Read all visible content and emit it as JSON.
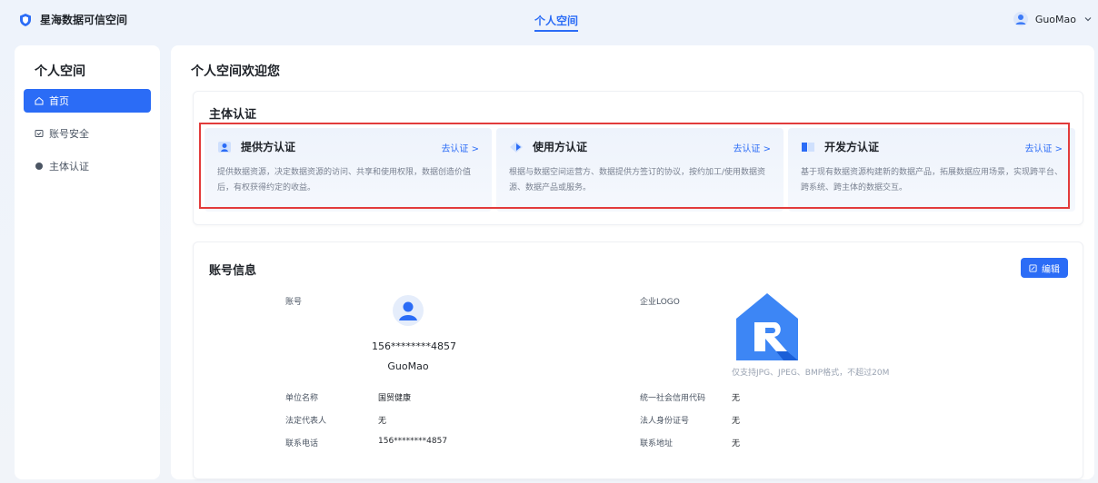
{
  "header": {
    "app_name": "星海数据可信空间",
    "nav_active": "个人空间",
    "user_name": "GuoMao"
  },
  "sidebar": {
    "title": "个人空间",
    "items": [
      {
        "label": "首页",
        "icon": "home-icon",
        "active": true
      },
      {
        "label": "账号安全",
        "icon": "shield-icon",
        "active": false
      },
      {
        "label": "主体认证",
        "icon": "dot-icon",
        "active": false
      }
    ]
  },
  "main": {
    "welcome": "个人空间欢迎您",
    "auth": {
      "title": "主体认证",
      "tiles": [
        {
          "name": "提供方认证",
          "link": "去认证 >",
          "desc": "提供数据资源，决定数据资源的访问、共享和使用权限，数据创造价值后，有权获得约定的收益。",
          "icon": "provider-icon"
        },
        {
          "name": "使用方认证",
          "link": "去认证 >",
          "desc": "根据与数据空间运营方、数据提供方签订的协议，按约加工/使用数据资源、数据产品或服务。",
          "icon": "user-icon"
        },
        {
          "name": "开发方认证",
          "link": "去认证 >",
          "desc": "基于现有数据资源构建新的数据产品，拓展数据应用场景，实现跨平台、跨系统、跨主体的数据交互。",
          "icon": "developer-icon"
        }
      ]
    },
    "account": {
      "title": "账号信息",
      "edit_label": "编辑",
      "account_label": "账号",
      "phone_masked": "156********4857",
      "username": "GuoMao",
      "logo_label": "企业LOGO",
      "logo_hint": "仅支持JPG、JPEG、BMP格式，不超过20M",
      "fields_left": [
        {
          "label": "单位名称",
          "value": "国贸健康"
        },
        {
          "label": "法定代表人",
          "value": "无"
        },
        {
          "label": "联系电话",
          "value": "156********4857"
        }
      ],
      "fields_right": [
        {
          "label": "统一社会信用代码",
          "value": "无"
        },
        {
          "label": "法人身份证号",
          "value": "无"
        },
        {
          "label": "联系地址",
          "value": "无"
        }
      ]
    }
  },
  "colors": {
    "accent": "#2b6cf6",
    "highlight": "#e23b3b"
  }
}
